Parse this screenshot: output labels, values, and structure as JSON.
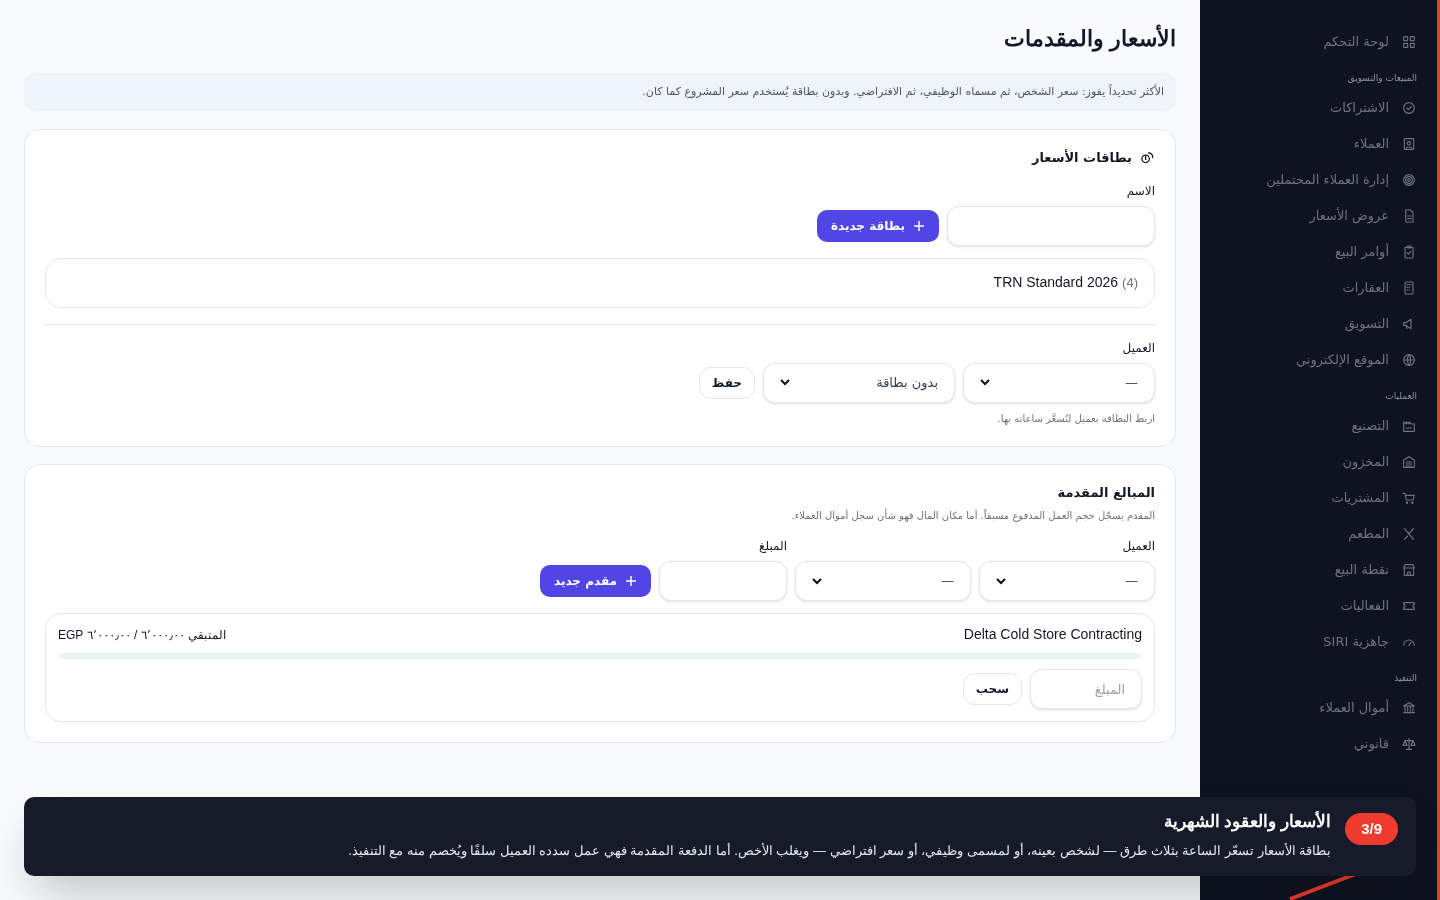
{
  "page": {
    "title": "الأسعار والمقدمات",
    "notice": "الأكثر تحديداً يفوز: سعر الشخص، ثم مسماه الوظيفي، ثم الافتراضي. وبدون بطاقة يُستخدم سعر المشروع كما كان."
  },
  "rate_cards": {
    "title": "بطاقات الأسعار",
    "name_label": "الاسم",
    "new_button": "بطاقة جديدة",
    "cards": [
      {
        "name": "TRN Standard 2026",
        "count": "(4)"
      }
    ],
    "client_label": "العميل",
    "client_select": "—",
    "card_select": "بدون بطاقة",
    "save_button": "حفظ",
    "hint": "اربط البطاقة بعميل لتُسعَّر ساعاته بها."
  },
  "advances": {
    "title": "المبالغ المقدمة",
    "subtitle": "المقدم يسجّل حجم العمل المدفوع مسبقاً. أما مكان المال فهو شأن سجل أموال العملاء.",
    "client_label": "العميل",
    "amount_label": "المبلغ",
    "client_select": "—",
    "select_2": "—",
    "new_button": "مقدم جديد",
    "entries": [
      {
        "client": "Delta Cold Store Contracting",
        "remaining": "المتبقي ٦٬٠٠٠٫٠٠ / ٦٬٠٠٠٫٠٠ EGP",
        "amount_placeholder": "المبلغ",
        "withdraw_button": "سحب"
      }
    ]
  },
  "sidebar": {
    "items": [
      {
        "kind": "item",
        "label": "لوحة التحكم"
      },
      {
        "kind": "section",
        "label": "المبيعات والتسويق"
      },
      {
        "kind": "item",
        "label": "الاشتراكات"
      },
      {
        "kind": "item",
        "label": "العملاء"
      },
      {
        "kind": "item",
        "label": "إدارة العملاء المحتملين"
      },
      {
        "kind": "item",
        "label": "عروض الأسعار"
      },
      {
        "kind": "item",
        "label": "أوامر البيع"
      },
      {
        "kind": "item",
        "label": "العقارات"
      },
      {
        "kind": "item",
        "label": "التسويق"
      },
      {
        "kind": "item",
        "label": "الموقع الإلكتروني"
      },
      {
        "kind": "section",
        "label": "العمليات"
      },
      {
        "kind": "item",
        "label": "التصنيع"
      },
      {
        "kind": "item",
        "label": "المخزون"
      },
      {
        "kind": "item",
        "label": "المشتريات"
      },
      {
        "kind": "item",
        "label": "المطعم"
      },
      {
        "kind": "item",
        "label": "نقطة البيع"
      },
      {
        "kind": "item",
        "label": "الفعاليات"
      },
      {
        "kind": "item",
        "label": "جاهزية SIRI"
      },
      {
        "kind": "section",
        "label": "التنفيذ"
      },
      {
        "kind": "item",
        "label": "أموال العملاء"
      },
      {
        "kind": "item",
        "label": "قانوني"
      }
    ]
  },
  "tour": {
    "step": "3/9",
    "title": "الأسعار والعقود الشهرية",
    "text": "بطاقة الأسعار تسعّر الساعة بثلاث طرق — لشخص بعينه، أو لمسمى وظيفي، أو سعر افتراضي — ويغلب الأخص. أما الدفعة المقدمة فهي عمل سدده العميل سلفًا ويُخصم منه مع التنفيذ."
  }
}
